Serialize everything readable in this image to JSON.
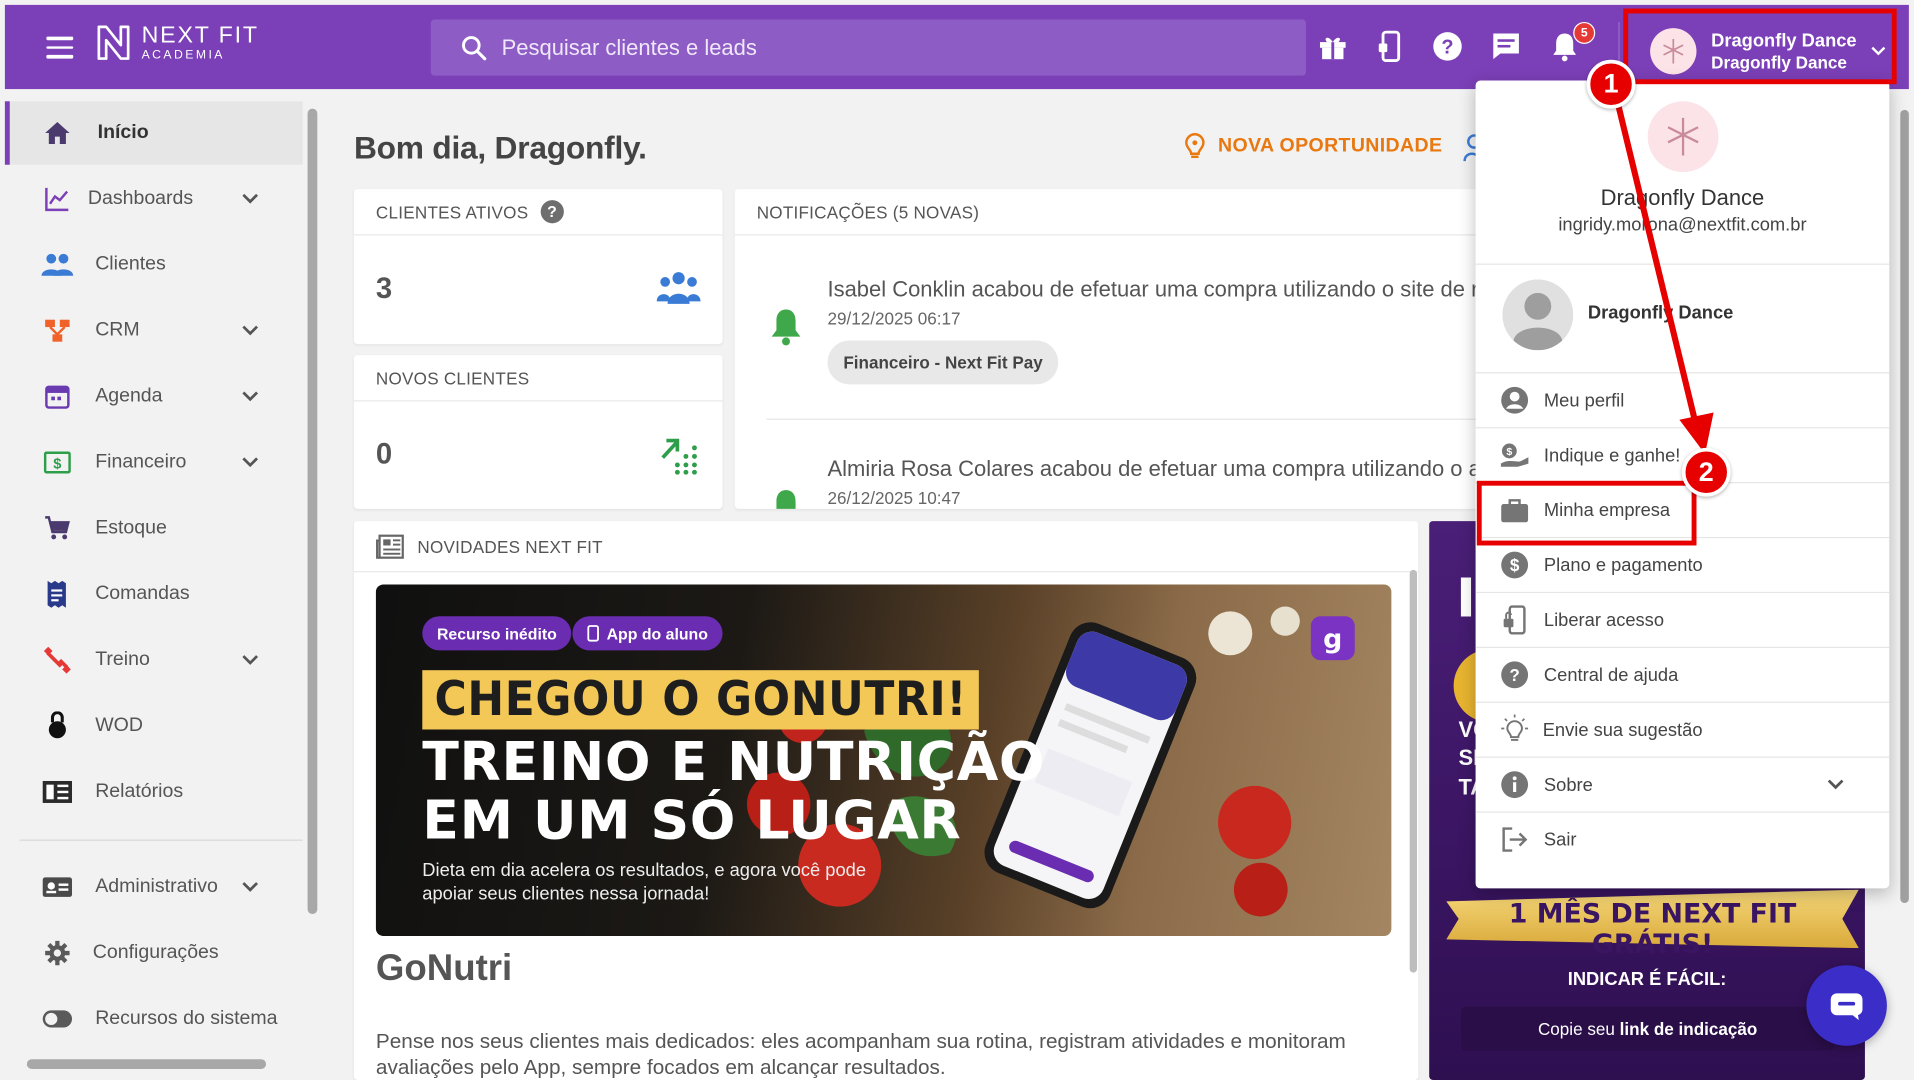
{
  "topbar": {
    "logo_line1": "NEXT FIT",
    "logo_line2": "ACADEMIA",
    "search_placeholder": "Pesquisar clientes e leads",
    "notification_count": "5",
    "profile_name": "Dragonfly Dance",
    "profile_subname": "Dragonfly Dance",
    "accent_color": "#7b3fb7"
  },
  "sidebar": {
    "items": [
      {
        "label": "Início",
        "icon": "home-icon"
      },
      {
        "label": "Dashboards",
        "icon": "chart-line-icon"
      },
      {
        "label": "Clientes",
        "icon": "people-icon"
      },
      {
        "label": "CRM",
        "icon": "crm-icon"
      },
      {
        "label": "Agenda",
        "icon": "calendar-icon"
      },
      {
        "label": "Financeiro",
        "icon": "money-icon"
      },
      {
        "label": "Estoque",
        "icon": "cart-icon"
      },
      {
        "label": "Comandas",
        "icon": "receipt-icon"
      },
      {
        "label": "Treino",
        "icon": "dumbbell-icon"
      },
      {
        "label": "WOD",
        "icon": "kettlebell-icon"
      },
      {
        "label": "Relatórios",
        "icon": "report-icon"
      },
      {
        "label": "Administrativo",
        "icon": "id-card-icon"
      },
      {
        "label": "Configurações",
        "icon": "gear-icon"
      },
      {
        "label": "Recursos do sistema",
        "icon": "toggle-icon"
      }
    ]
  },
  "main": {
    "greeting": "Bom dia, Dragonfly.",
    "nova_oportunidade": "NOVA OPORTUNIDADE",
    "clientes_ativos": {
      "label": "CLIENTES ATIVOS",
      "help": "?",
      "value": "3"
    },
    "novos_clientes": {
      "label": "NOVOS CLIENTES",
      "value": "0"
    },
    "notifications": {
      "header": "NOTIFICAÇÕES (5 NOVAS)",
      "items": [
        {
          "title": "Isabel Conklin acabou de efetuar uma compra utilizando o site de r",
          "date": "29/12/2025 06:17",
          "chip": "Financeiro - Next Fit Pay"
        },
        {
          "title": "Almiria Rosa Colares acabou de efetuar uma compra utilizando o a",
          "date": "26/12/2025 10:47"
        }
      ]
    },
    "news": {
      "header": "NOVIDADES NEXT FIT",
      "chip1": "Recurso inédito",
      "chip2": "App do aluno",
      "headline1": "CHEGOU O GONUTRI!",
      "headline2": "TREINO E NUTRIÇÃO",
      "headline3": "EM UM SÓ LUGAR",
      "description": "Dieta em dia acelera os resultados, e agora você pode apoiar seus clientes nessa jornada!",
      "title": "GoNutri",
      "text": "Pense nos seus clientes mais dedicados: eles acompanham sua rotina, registram atividades e monitoram avaliações pelo App, sempre focados em alcançar resultados."
    },
    "promo": {
      "partial_letter": "I",
      "side_text": "VO SE TA",
      "headline": "1 MÊS DE NEXT FIT GRÁTIS!",
      "subtitle": "INDICAR É FÁCIL:",
      "cta_prefix": "Copie seu ",
      "cta_bold": "link de indicação"
    }
  },
  "menu": {
    "account_name": "Dragonfly Dance",
    "account_email": "ingridy.morona@nextfit.com.br",
    "company_name": "Dragonfly Dance",
    "items": [
      {
        "label": "Meu perfil",
        "icon": "account-circle-icon"
      },
      {
        "label": "Indique e ganhe!",
        "icon": "money-hand-icon"
      },
      {
        "label": "Minha empresa",
        "icon": "briefcase-icon"
      },
      {
        "label": "Plano e pagamento",
        "icon": "dollar-circle-icon"
      },
      {
        "label": "Liberar acesso",
        "icon": "device-unlock-icon"
      },
      {
        "label": "Central de ajuda",
        "icon": "help-circle-icon"
      },
      {
        "label": "Envie sua sugestão",
        "icon": "lightbulb-icon"
      },
      {
        "label": "Sobre",
        "icon": "info-icon"
      },
      {
        "label": "Sair",
        "icon": "logout-icon"
      }
    ]
  },
  "annotations": {
    "step1": "1",
    "step2": "2",
    "color": "#e60000"
  }
}
